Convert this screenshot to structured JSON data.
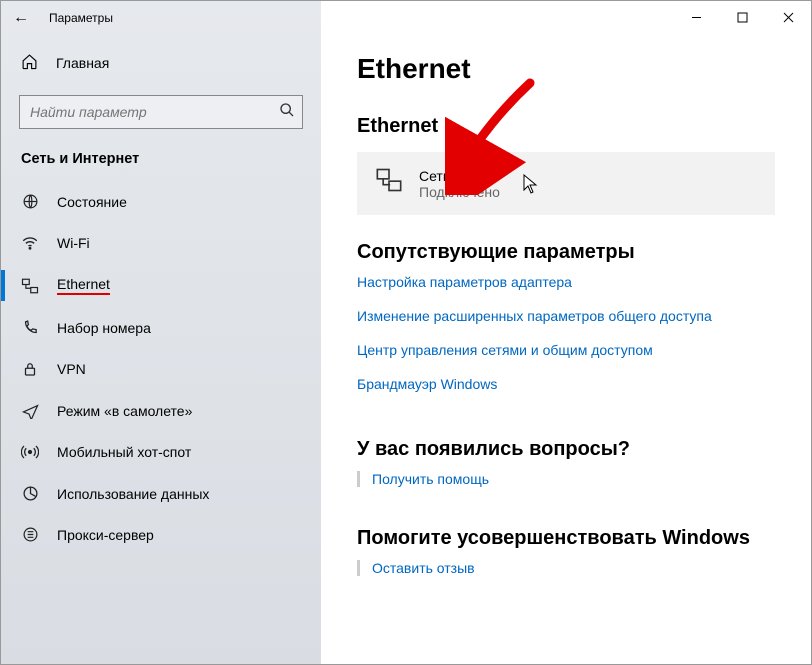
{
  "titlebar": {
    "title": "Параметры"
  },
  "home": {
    "label": "Главная"
  },
  "search": {
    "placeholder": "Найти параметр"
  },
  "sectionHead": "Сеть и Интернет",
  "nav": {
    "status": "Состояние",
    "wifi": "Wi-Fi",
    "ethernet": "Ethernet",
    "dialup": "Набор номера",
    "vpn": "VPN",
    "airplane": "Режим «в самолете»",
    "hotspot": "Мобильный хот-спот",
    "datausage": "Использование данных",
    "proxy": "Прокси-сервер"
  },
  "page": {
    "title": "Ethernet",
    "subhead1": "Ethernet",
    "netcard": {
      "name": "Сеть",
      "status": "Подключено"
    },
    "related": {
      "heading": "Сопутствующие параметры",
      "adapter": "Настройка параметров адаптера",
      "sharing": "Изменение расширенных параметров общего доступа",
      "center": "Центр управления сетями и общим доступом",
      "firewall": "Брандмауэр Windows"
    },
    "help": {
      "heading": "У вас появились вопросы?",
      "link": "Получить помощь"
    },
    "feedback": {
      "heading": "Помогите усовершенствовать Windows",
      "link": "Оставить отзыв"
    }
  }
}
